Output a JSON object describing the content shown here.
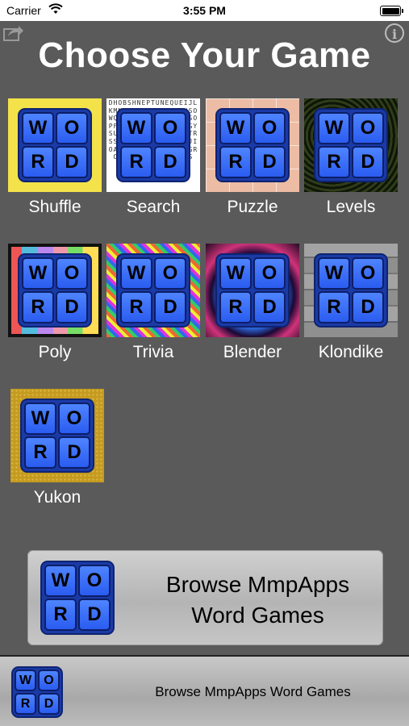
{
  "status_bar": {
    "carrier": "Carrier",
    "time": "3:55 PM"
  },
  "title": "Choose Your Game",
  "logo_letters": [
    "W",
    "O",
    "R",
    "D"
  ],
  "games": [
    {
      "label": "Shuffle"
    },
    {
      "label": "Search"
    },
    {
      "label": "Puzzle"
    },
    {
      "label": "Levels"
    },
    {
      "label": "Poly"
    },
    {
      "label": "Trivia"
    },
    {
      "label": "Blender"
    },
    {
      "label": "Klondike"
    },
    {
      "label": "Yukon"
    }
  ],
  "browse_button": {
    "line1": "Browse MmpApps",
    "line2": "Word Games"
  },
  "ad_banner": {
    "text": "Browse MmpApps Word Games"
  },
  "search_letters": "DHOBSHNEPTUNEQUEIJLKMNTWDMEAIBJVOSTHSOWQHIDJSCSPZYNKOTMSOPFXRZAPSFAMETRJSUGYSUOILHUSNERGEERAETRSSNTWDECGTGSUPCRKJIOAVOZEDARJSBTPCOEGROECESZEEHOPHSLUMS"
}
